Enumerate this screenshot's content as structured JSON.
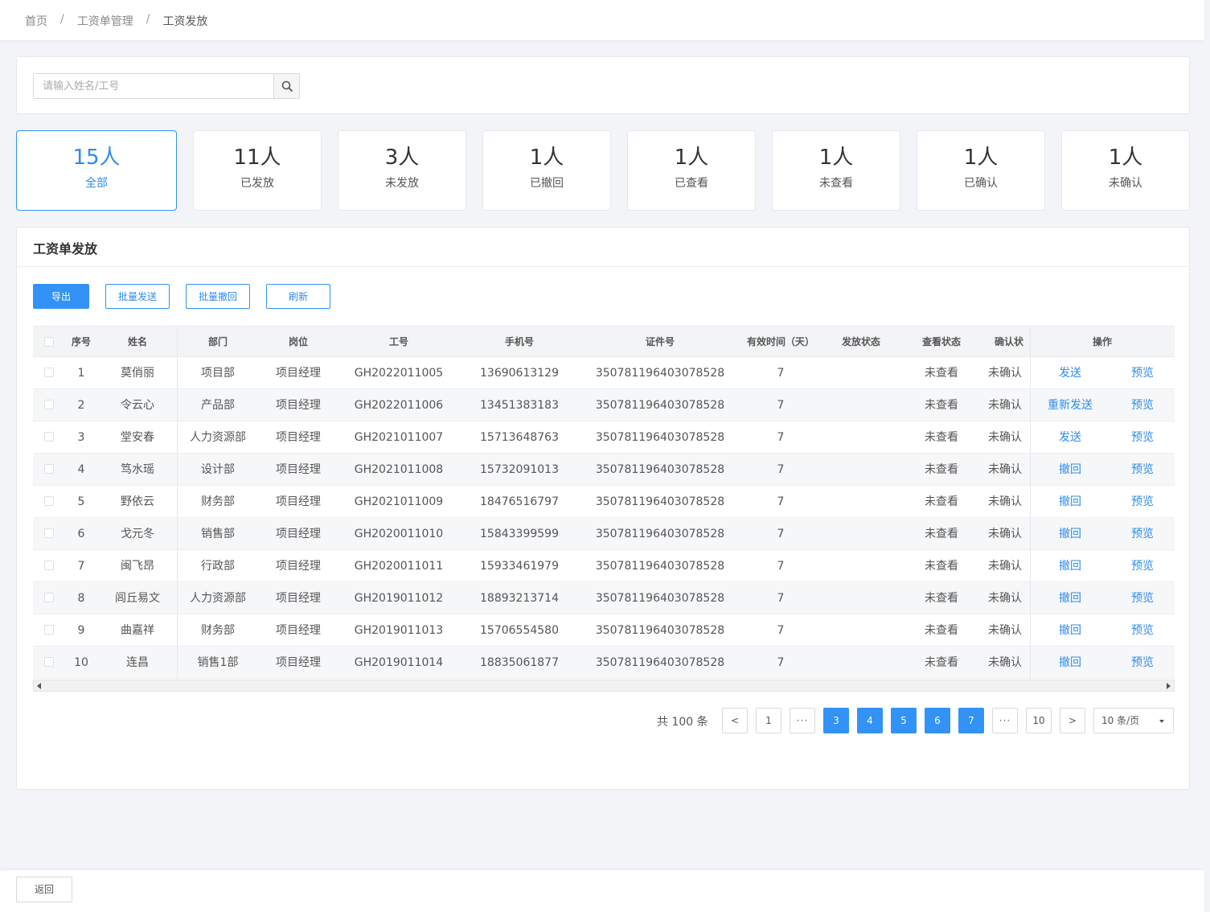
{
  "breadcrumb": {
    "items": [
      "首页",
      "工资单管理",
      "工资发放"
    ],
    "separator": "/"
  },
  "search": {
    "placeholder": "请输入姓名/工号",
    "value": "",
    "icon": "search-icon"
  },
  "stats": [
    {
      "value": "15人",
      "label": "全部",
      "active": true
    },
    {
      "value": "11人",
      "label": "已发放",
      "active": false
    },
    {
      "value": "3人",
      "label": "未发放",
      "active": false
    },
    {
      "value": "1人",
      "label": "已撤回",
      "active": false
    },
    {
      "value": "1人",
      "label": "已查看",
      "active": false
    },
    {
      "value": "1人",
      "label": "未查看",
      "active": false
    },
    {
      "value": "1人",
      "label": "已确认",
      "active": false
    },
    {
      "value": "1人",
      "label": "未确认",
      "active": false
    }
  ],
  "panel": {
    "title": "工资单发放"
  },
  "toolbar": {
    "export_label": "导出",
    "batch_send_label": "批量发送",
    "batch_revoke_label": "批量撤回",
    "refresh_label": "刷新"
  },
  "table": {
    "columns": {
      "index": "序号",
      "name": "姓名",
      "department": "部门",
      "position": "岗位",
      "job_number": "工号",
      "phone": "手机号",
      "id_number": "证件号",
      "valid_days": "有效时间（天）",
      "send_status": "发放状态",
      "view_status": "查看状态",
      "confirm_status": "确认状",
      "actions": "操作"
    },
    "rows": [
      {
        "index": "1",
        "name": "莫俏丽",
        "department": "项目部",
        "position": "项目经理",
        "job_number": "GH2022011005",
        "phone": "13690613129",
        "id_number": "350781196403078528",
        "valid_days": "7",
        "send_status": "",
        "view_status": "未查看",
        "confirm_status": "未确认",
        "action": "发送",
        "preview": "预览"
      },
      {
        "index": "2",
        "name": "令云心",
        "department": "产品部",
        "position": "项目经理",
        "job_number": "GH2022011006",
        "phone": "13451383183",
        "id_number": "350781196403078528",
        "valid_days": "7",
        "send_status": "",
        "view_status": "未查看",
        "confirm_status": "未确认",
        "action": "重新发送",
        "preview": "预览"
      },
      {
        "index": "3",
        "name": "堂安春",
        "department": "人力资源部",
        "position": "项目经理",
        "job_number": "GH2021011007",
        "phone": "15713648763",
        "id_number": "350781196403078528",
        "valid_days": "7",
        "send_status": "",
        "view_status": "未查看",
        "confirm_status": "未确认",
        "action": "发送",
        "preview": "预览"
      },
      {
        "index": "4",
        "name": "笃水瑶",
        "department": "设计部",
        "position": "项目经理",
        "job_number": "GH2021011008",
        "phone": "15732091013",
        "id_number": "350781196403078528",
        "valid_days": "7",
        "send_status": "",
        "view_status": "未查看",
        "confirm_status": "未确认",
        "action": "撤回",
        "preview": "预览"
      },
      {
        "index": "5",
        "name": "野依云",
        "department": "财务部",
        "position": "项目经理",
        "job_number": "GH2021011009",
        "phone": "18476516797",
        "id_number": "350781196403078528",
        "valid_days": "7",
        "send_status": "",
        "view_status": "未查看",
        "confirm_status": "未确认",
        "action": "撤回",
        "preview": "预览"
      },
      {
        "index": "6",
        "name": "戈元冬",
        "department": "销售部",
        "position": "项目经理",
        "job_number": "GH2020011010",
        "phone": "15843399599",
        "id_number": "350781196403078528",
        "valid_days": "7",
        "send_status": "",
        "view_status": "未查看",
        "confirm_status": "未确认",
        "action": "撤回",
        "preview": "预览"
      },
      {
        "index": "7",
        "name": "闽飞昂",
        "department": "行政部",
        "position": "项目经理",
        "job_number": "GH2020011011",
        "phone": "15933461979",
        "id_number": "350781196403078528",
        "valid_days": "7",
        "send_status": "",
        "view_status": "未查看",
        "confirm_status": "未确认",
        "action": "撤回",
        "preview": "预览"
      },
      {
        "index": "8",
        "name": "闾丘易文",
        "department": "人力资源部",
        "position": "项目经理",
        "job_number": "GH2019011012",
        "phone": "18893213714",
        "id_number": "350781196403078528",
        "valid_days": "7",
        "send_status": "",
        "view_status": "未查看",
        "confirm_status": "未确认",
        "action": "撤回",
        "preview": "预览"
      },
      {
        "index": "9",
        "name": "曲嘉祥",
        "department": "财务部",
        "position": "项目经理",
        "job_number": "GH2019011013",
        "phone": "15706554580",
        "id_number": "350781196403078528",
        "valid_days": "7",
        "send_status": "",
        "view_status": "未查看",
        "confirm_status": "未确认",
        "action": "撤回",
        "preview": "预览"
      },
      {
        "index": "10",
        "name": "连昌",
        "department": "销售1部",
        "position": "项目经理",
        "job_number": "GH2019011014",
        "phone": "18835061877",
        "id_number": "350781196403078528",
        "valid_days": "7",
        "send_status": "",
        "view_status": "未查看",
        "confirm_status": "未确认",
        "action": "撤回",
        "preview": "预览"
      }
    ]
  },
  "pagination": {
    "total_text": "共 100 条",
    "prev": "<",
    "next": ">",
    "pages": [
      {
        "label": "1",
        "active": false
      },
      {
        "label": "···",
        "active": false,
        "dots": true
      },
      {
        "label": "3",
        "active": true
      },
      {
        "label": "4",
        "active": true
      },
      {
        "label": "5",
        "active": true
      },
      {
        "label": "6",
        "active": true
      },
      {
        "label": "7",
        "active": true
      },
      {
        "label": "···",
        "active": false,
        "dots": true
      },
      {
        "label": "10",
        "active": false
      }
    ],
    "page_size": "10 条/页"
  },
  "footer": {
    "back_label": "返回"
  },
  "colors": {
    "accent": "#3392f5",
    "link": "#2d8cf0",
    "background": "#f3f4f7"
  }
}
